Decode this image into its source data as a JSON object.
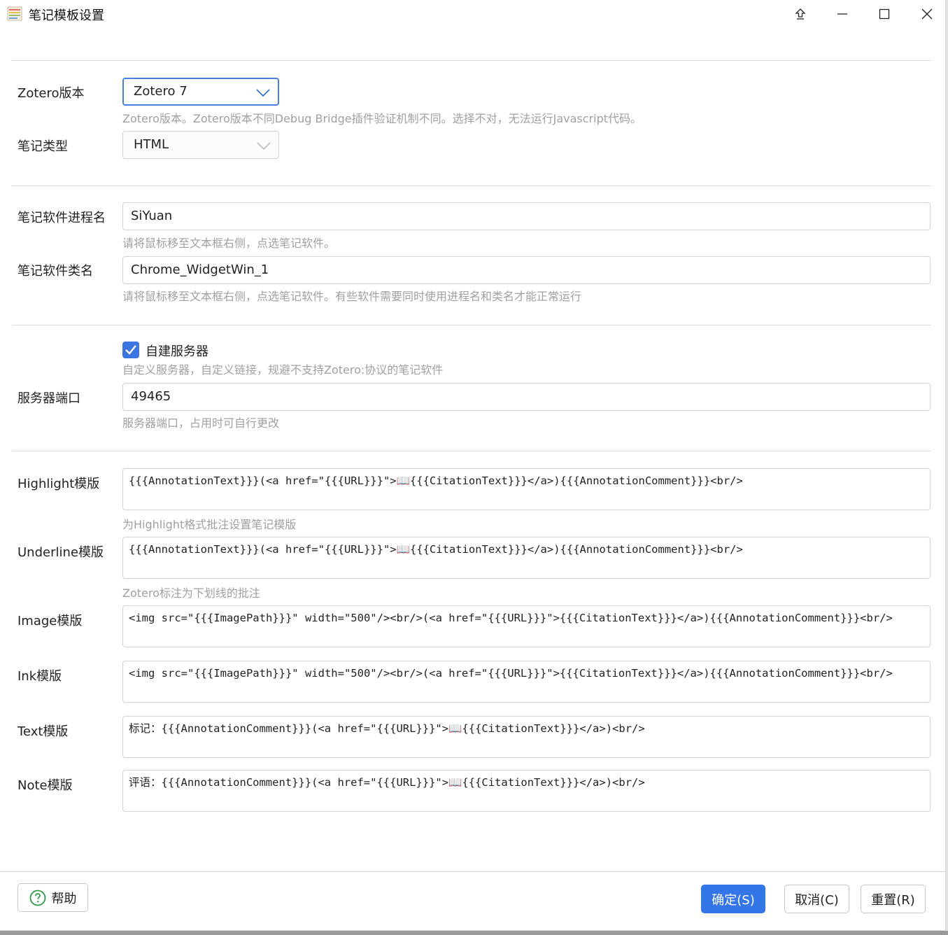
{
  "window": {
    "title": "笔记模板设置"
  },
  "zotero_version": {
    "label": "Zotero版本",
    "value": "Zotero 7",
    "hint": "Zotero版本。Zotero版本不同Debug Bridge插件验证机制不同。选择不对，无法运行Javascript代码。"
  },
  "note_type": {
    "label": "笔记类型",
    "value": "HTML"
  },
  "process_name": {
    "label": "笔记软件进程名",
    "value": "SiYuan",
    "hint": "请将鼠标移至文本框右侧，点选笔记软件。"
  },
  "class_name": {
    "label": "笔记软件类名",
    "value": "Chrome_WidgetWin_1",
    "hint": "请将鼠标移至文本框右侧，点选笔记软件。有些软件需要同时使用进程名和类名才能正常运行"
  },
  "self_server": {
    "label": "自建服务器",
    "checked": true,
    "hint": "自定义服务器，自定义链接，规避不支持Zotero:协议的笔记软件"
  },
  "server_port": {
    "label": "服务器端口",
    "value": "49465",
    "hint": "服务器端口，占用时可自行更改"
  },
  "templates": {
    "highlight": {
      "label": "Highlight模版",
      "value": "{{{AnnotationText}}}(<a href=\"{{{URL}}}\">📖{{{CitationText}}}</a>){{{AnnotationComment}}}<br/>",
      "hint": "为Highlight格式批注设置笔记模版"
    },
    "underline": {
      "label": "Underline模版",
      "value": "{{{AnnotationText}}}(<a href=\"{{{URL}}}\">📖{{{CitationText}}}</a>){{{AnnotationComment}}}<br/>",
      "hint": "Zotero标注为下划线的批注"
    },
    "image": {
      "label": "Image模版",
      "value": "<img src=\"{{{ImagePath}}}\" width=\"500\"/><br/>(<a href=\"{{{URL}}}\">{{{CitationText}}}</a>){{{AnnotationComment}}}<br/>"
    },
    "ink": {
      "label": "Ink模版",
      "value": "<img src=\"{{{ImagePath}}}\" width=\"500\"/><br/>(<a href=\"{{{URL}}}\">{{{CitationText}}}</a>){{{AnnotationComment}}}<br/>"
    },
    "text": {
      "label": "Text模版",
      "value": "标记：{{{AnnotationComment}}}(<a href=\"{{{URL}}}\">📖{{{CitationText}}}</a>)<br/>"
    },
    "note": {
      "label": "Note模版",
      "value": "评语：{{{AnnotationComment}}}(<a href=\"{{{URL}}}\">📖{{{CitationText}}}</a>)<br/>"
    }
  },
  "footer": {
    "help_label": "帮助",
    "ok_label": "确定(S)",
    "cancel_label": "取消(C)",
    "reset_label": "重置(R)"
  },
  "colors": {
    "accent": "#3475e8",
    "hint": "#a0a0a0"
  }
}
